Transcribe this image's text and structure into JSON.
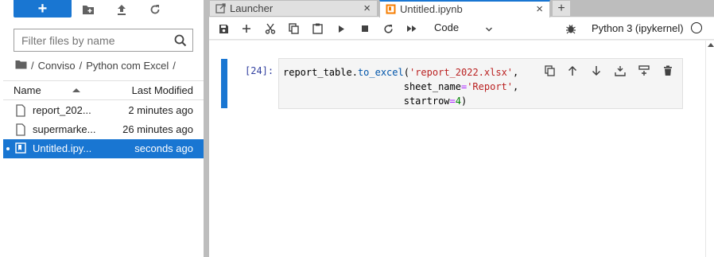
{
  "file_browser": {
    "new_label": "+",
    "filter_placeholder": "Filter files by name",
    "breadcrumb": {
      "root": "/",
      "segments": [
        "Conviso",
        "Python com Excel"
      ],
      "separator": "/",
      "trailing": "/"
    },
    "columns": {
      "name": "Name",
      "modified": "Last Modified"
    },
    "files": [
      {
        "name": "report_202...",
        "modified": "2 minutes ago",
        "type": "file"
      },
      {
        "name": "supermarke...",
        "modified": "26 minutes ago",
        "type": "file"
      },
      {
        "name": "Untitled.ipy...",
        "modified": "seconds ago",
        "type": "notebook",
        "selected": true,
        "running": true
      }
    ]
  },
  "tabs": [
    {
      "label": "Launcher",
      "icon": "launcher-icon",
      "active": false
    },
    {
      "label": "Untitled.ipynb",
      "icon": "notebook-icon",
      "active": true
    }
  ],
  "notebook_toolbar": {
    "cell_type": "Code",
    "kernel_name": "Python 3 (ipykernel)"
  },
  "cell": {
    "prompt": "[24]:",
    "code": {
      "line1": [
        "report_table",
        ".",
        "to_excel",
        "(",
        "'report_2022.xlsx'",
        ","
      ],
      "line2": [
        "sheet_name",
        "=",
        "'Report'",
        ","
      ],
      "line3": [
        "startrow",
        "=",
        "4",
        ")"
      ]
    }
  },
  "colors": {
    "accent": "#1976d2",
    "splitter": "#bdbdbd",
    "cell_background": "#f5f5f5",
    "prompt": "#303f9f",
    "string": "#ba2121",
    "number": "#008000",
    "method": "#0055aa"
  }
}
